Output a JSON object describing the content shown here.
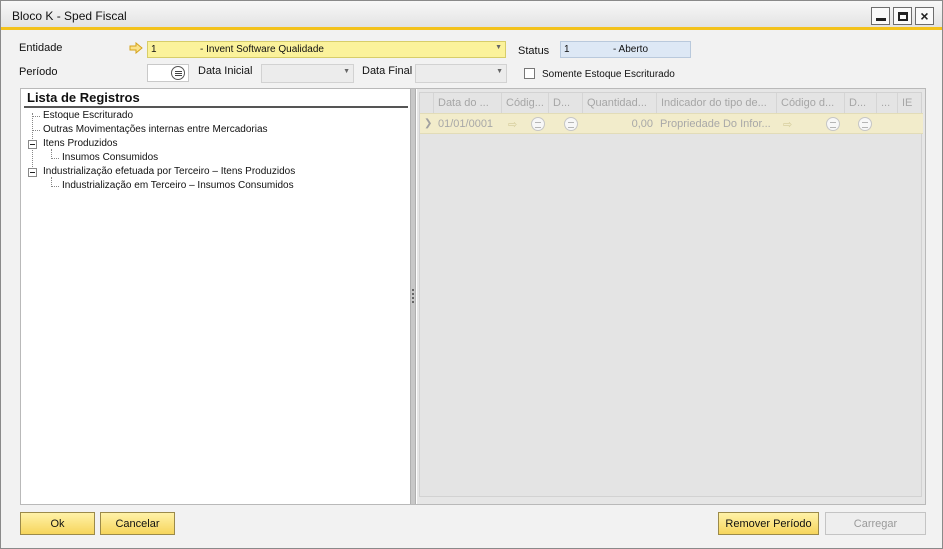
{
  "window": {
    "title": "Bloco K - Sped Fiscal"
  },
  "header": {
    "entidade_label": "Entidade",
    "entidade_code": "1",
    "entidade_name": "- Invent Software Qualidade",
    "status_label": "Status",
    "status_code": "1",
    "status_name": "- Aberto",
    "periodo_label": "Período",
    "periodo_value": "",
    "data_inicial_label": "Data Inicial",
    "data_final_label": "Data Final",
    "somente_label": "Somente Estoque Escriturado"
  },
  "tree": {
    "title": "Lista de Registros",
    "items": [
      {
        "label": "Estoque Escriturado",
        "level": 0
      },
      {
        "label": "Outras Movimentações internas entre Mercadorias",
        "level": 0
      },
      {
        "label": "Itens Produzidos",
        "level": 0,
        "expanded": true
      },
      {
        "label": "Insumos Consumidos",
        "level": 1
      },
      {
        "label": "Industrialização efetuada por Terceiro – Itens Produzidos",
        "level": 0,
        "expanded": true
      },
      {
        "label": "Industrialização em Terceiro – Insumos Consumidos",
        "level": 1
      }
    ]
  },
  "grid": {
    "columns": [
      "Data do ...",
      "Códig...",
      "D...",
      "Quantidad...",
      "Indicador do tipo de...",
      "Código d...",
      "D...",
      "...",
      "IE"
    ],
    "row": {
      "date": "01/01/0001",
      "quantity": "0,00",
      "indicator": "Propriedade Do Infor..."
    }
  },
  "buttons": {
    "ok": "Ok",
    "cancel": "Cancelar",
    "remove_period": "Remover Período",
    "load": "Carregar"
  },
  "colors": {
    "accent": "#f3c21c",
    "field_highlight": "#fbf29b",
    "status_field": "#dde8f5",
    "grid_row": "#f2eccb"
  }
}
